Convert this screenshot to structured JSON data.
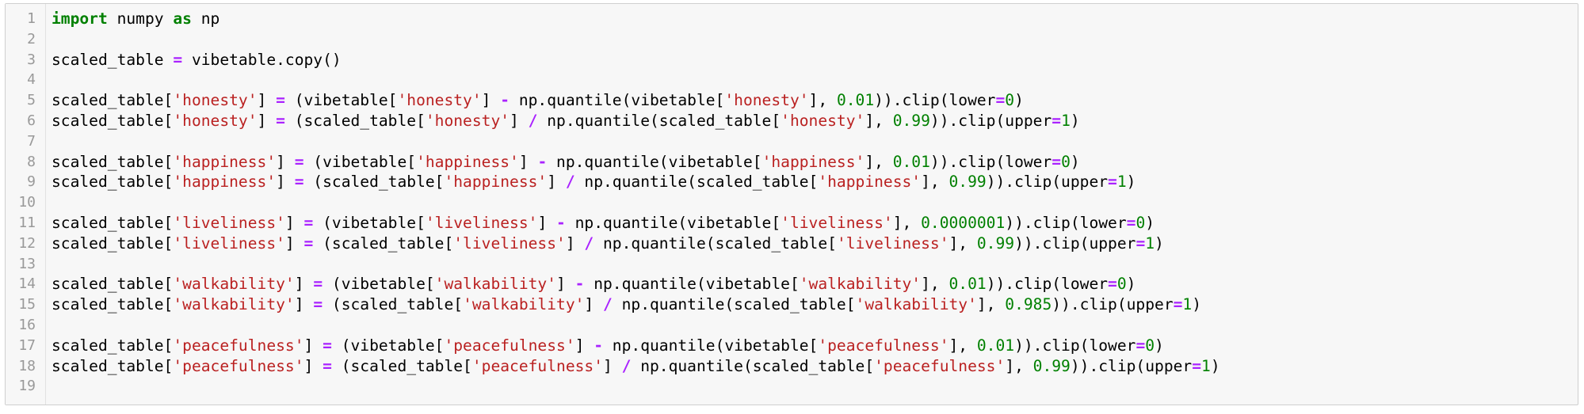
{
  "editor": {
    "lines": [
      {
        "n": "1",
        "tokens": [
          [
            "kw",
            "import"
          ],
          [
            "id",
            " numpy "
          ],
          [
            "kw",
            "as"
          ],
          [
            "id",
            " np"
          ]
        ]
      },
      {
        "n": "2",
        "tokens": []
      },
      {
        "n": "3",
        "tokens": [
          [
            "id",
            "scaled_table "
          ],
          [
            "op",
            "="
          ],
          [
            "id",
            " vibetable.copy()"
          ]
        ]
      },
      {
        "n": "4",
        "tokens": []
      },
      {
        "n": "5",
        "tokens": [
          [
            "id",
            "scaled_table["
          ],
          [
            "str",
            "'honesty'"
          ],
          [
            "id",
            "] "
          ],
          [
            "op",
            "="
          ],
          [
            "id",
            " (vibetable["
          ],
          [
            "str",
            "'honesty'"
          ],
          [
            "id",
            "] "
          ],
          [
            "op",
            "-"
          ],
          [
            "id",
            " np.quantile(vibetable["
          ],
          [
            "str",
            "'honesty'"
          ],
          [
            "id",
            "], "
          ],
          [
            "num",
            "0.01"
          ],
          [
            "id",
            ")).clip(lower"
          ],
          [
            "op",
            "="
          ],
          [
            "num",
            "0"
          ],
          [
            "id",
            ")"
          ]
        ]
      },
      {
        "n": "6",
        "tokens": [
          [
            "id",
            "scaled_table["
          ],
          [
            "str",
            "'honesty'"
          ],
          [
            "id",
            "] "
          ],
          [
            "op",
            "="
          ],
          [
            "id",
            " (scaled_table["
          ],
          [
            "str",
            "'honesty'"
          ],
          [
            "id",
            "] "
          ],
          [
            "op",
            "/"
          ],
          [
            "id",
            " np.quantile(scaled_table["
          ],
          [
            "str",
            "'honesty'"
          ],
          [
            "id",
            "], "
          ],
          [
            "num",
            "0.99"
          ],
          [
            "id",
            ")).clip(upper"
          ],
          [
            "op",
            "="
          ],
          [
            "num",
            "1"
          ],
          [
            "id",
            ")"
          ]
        ]
      },
      {
        "n": "7",
        "tokens": []
      },
      {
        "n": "8",
        "tokens": [
          [
            "id",
            "scaled_table["
          ],
          [
            "str",
            "'happiness'"
          ],
          [
            "id",
            "] "
          ],
          [
            "op",
            "="
          ],
          [
            "id",
            " (vibetable["
          ],
          [
            "str",
            "'happiness'"
          ],
          [
            "id",
            "] "
          ],
          [
            "op",
            "-"
          ],
          [
            "id",
            " np.quantile(vibetable["
          ],
          [
            "str",
            "'happiness'"
          ],
          [
            "id",
            "], "
          ],
          [
            "num",
            "0.01"
          ],
          [
            "id",
            ")).clip(lower"
          ],
          [
            "op",
            "="
          ],
          [
            "num",
            "0"
          ],
          [
            "id",
            ")"
          ]
        ]
      },
      {
        "n": "9",
        "tokens": [
          [
            "id",
            "scaled_table["
          ],
          [
            "str",
            "'happiness'"
          ],
          [
            "id",
            "] "
          ],
          [
            "op",
            "="
          ],
          [
            "id",
            " (scaled_table["
          ],
          [
            "str",
            "'happiness'"
          ],
          [
            "id",
            "] "
          ],
          [
            "op",
            "/"
          ],
          [
            "id",
            " np.quantile(scaled_table["
          ],
          [
            "str",
            "'happiness'"
          ],
          [
            "id",
            "], "
          ],
          [
            "num",
            "0.99"
          ],
          [
            "id",
            ")).clip(upper"
          ],
          [
            "op",
            "="
          ],
          [
            "num",
            "1"
          ],
          [
            "id",
            ")"
          ]
        ]
      },
      {
        "n": "10",
        "tokens": []
      },
      {
        "n": "11",
        "tokens": [
          [
            "id",
            "scaled_table["
          ],
          [
            "str",
            "'liveliness'"
          ],
          [
            "id",
            "] "
          ],
          [
            "op",
            "="
          ],
          [
            "id",
            " (vibetable["
          ],
          [
            "str",
            "'liveliness'"
          ],
          [
            "id",
            "] "
          ],
          [
            "op",
            "-"
          ],
          [
            "id",
            " np.quantile(vibetable["
          ],
          [
            "str",
            "'liveliness'"
          ],
          [
            "id",
            "], "
          ],
          [
            "num",
            "0.0000001"
          ],
          [
            "id",
            ")).clip(lower"
          ],
          [
            "op",
            "="
          ],
          [
            "num",
            "0"
          ],
          [
            "id",
            ")"
          ]
        ]
      },
      {
        "n": "12",
        "tokens": [
          [
            "id",
            "scaled_table["
          ],
          [
            "str",
            "'liveliness'"
          ],
          [
            "id",
            "] "
          ],
          [
            "op",
            "="
          ],
          [
            "id",
            " (scaled_table["
          ],
          [
            "str",
            "'liveliness'"
          ],
          [
            "id",
            "] "
          ],
          [
            "op",
            "/"
          ],
          [
            "id",
            " np.quantile(scaled_table["
          ],
          [
            "str",
            "'liveliness'"
          ],
          [
            "id",
            "], "
          ],
          [
            "num",
            "0.99"
          ],
          [
            "id",
            ")).clip(upper"
          ],
          [
            "op",
            "="
          ],
          [
            "num",
            "1"
          ],
          [
            "id",
            ")"
          ]
        ]
      },
      {
        "n": "13",
        "tokens": []
      },
      {
        "n": "14",
        "tokens": [
          [
            "id",
            "scaled_table["
          ],
          [
            "str",
            "'walkability'"
          ],
          [
            "id",
            "] "
          ],
          [
            "op",
            "="
          ],
          [
            "id",
            " (vibetable["
          ],
          [
            "str",
            "'walkability'"
          ],
          [
            "id",
            "] "
          ],
          [
            "op",
            "-"
          ],
          [
            "id",
            " np.quantile(vibetable["
          ],
          [
            "str",
            "'walkability'"
          ],
          [
            "id",
            "], "
          ],
          [
            "num",
            "0.01"
          ],
          [
            "id",
            ")).clip(lower"
          ],
          [
            "op",
            "="
          ],
          [
            "num",
            "0"
          ],
          [
            "id",
            ")"
          ]
        ]
      },
      {
        "n": "15",
        "tokens": [
          [
            "id",
            "scaled_table["
          ],
          [
            "str",
            "'walkability'"
          ],
          [
            "id",
            "] "
          ],
          [
            "op",
            "="
          ],
          [
            "id",
            " (scaled_table["
          ],
          [
            "str",
            "'walkability'"
          ],
          [
            "id",
            "] "
          ],
          [
            "op",
            "/"
          ],
          [
            "id",
            " np.quantile(scaled_table["
          ],
          [
            "str",
            "'walkability'"
          ],
          [
            "id",
            "], "
          ],
          [
            "num",
            "0.985"
          ],
          [
            "id",
            ")).clip(upper"
          ],
          [
            "op",
            "="
          ],
          [
            "num",
            "1"
          ],
          [
            "id",
            ")"
          ]
        ]
      },
      {
        "n": "16",
        "tokens": []
      },
      {
        "n": "17",
        "tokens": [
          [
            "id",
            "scaled_table["
          ],
          [
            "str",
            "'peacefulness'"
          ],
          [
            "id",
            "] "
          ],
          [
            "op",
            "="
          ],
          [
            "id",
            " (vibetable["
          ],
          [
            "str",
            "'peacefulness'"
          ],
          [
            "id",
            "] "
          ],
          [
            "op",
            "-"
          ],
          [
            "id",
            " np.quantile(vibetable["
          ],
          [
            "str",
            "'peacefulness'"
          ],
          [
            "id",
            "], "
          ],
          [
            "num",
            "0.01"
          ],
          [
            "id",
            ")).clip(lower"
          ],
          [
            "op",
            "="
          ],
          [
            "num",
            "0"
          ],
          [
            "id",
            ")"
          ]
        ]
      },
      {
        "n": "18",
        "tokens": [
          [
            "id",
            "scaled_table["
          ],
          [
            "str",
            "'peacefulness'"
          ],
          [
            "id",
            "] "
          ],
          [
            "op",
            "="
          ],
          [
            "id",
            " (scaled_table["
          ],
          [
            "str",
            "'peacefulness'"
          ],
          [
            "id",
            "] "
          ],
          [
            "op",
            "/"
          ],
          [
            "id",
            " np.quantile(scaled_table["
          ],
          [
            "str",
            "'peacefulness'"
          ],
          [
            "id",
            "], "
          ],
          [
            "num",
            "0.99"
          ],
          [
            "id",
            ")).clip(upper"
          ],
          [
            "op",
            "="
          ],
          [
            "num",
            "1"
          ],
          [
            "id",
            ")"
          ]
        ]
      },
      {
        "n": "19",
        "tokens": []
      }
    ]
  },
  "colors": {
    "keyword": "#008000",
    "operator": "#aa22ff",
    "string": "#ba2121",
    "number": "#008000",
    "line_number": "#999999",
    "background": "#f7f7f7",
    "border": "#cfcfcf"
  }
}
